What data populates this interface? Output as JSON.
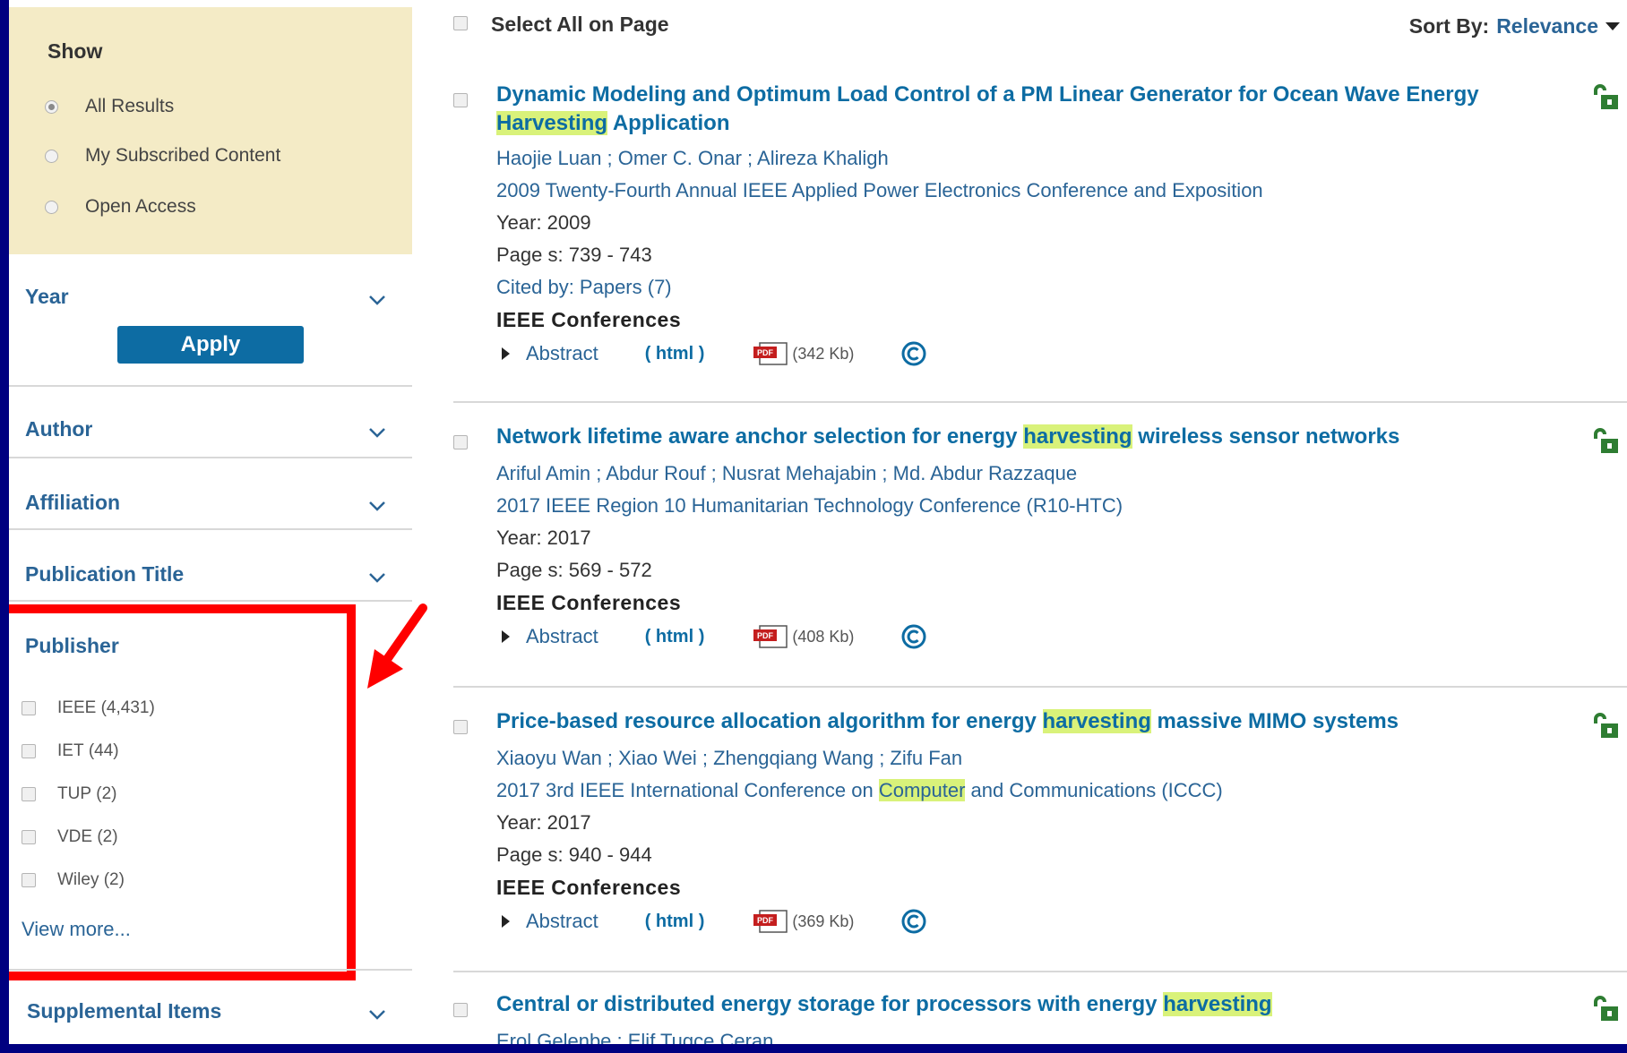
{
  "sidebar": {
    "show": {
      "title": "Show",
      "options": [
        {
          "label": "All Results",
          "selected": true
        },
        {
          "label": "My Subscribed Content",
          "selected": false
        },
        {
          "label": "Open Access",
          "selected": false
        }
      ]
    },
    "year": {
      "title": "Year",
      "apply_label": "Apply"
    },
    "author": {
      "title": "Author"
    },
    "affiliation": {
      "title": "Affiliation"
    },
    "publication_title": {
      "title": "Publication Title"
    },
    "publisher": {
      "title": "Publisher",
      "items": [
        {
          "name": "IEEE",
          "count": "(4,431)"
        },
        {
          "name": "IET",
          "count": "(44)"
        },
        {
          "name": "TUP",
          "count": "(2)"
        },
        {
          "name": "VDE",
          "count": "(2)"
        },
        {
          "name": "Wiley",
          "count": "(2)"
        }
      ],
      "view_more": "View more..."
    },
    "supplemental": {
      "title": "Supplemental Items"
    }
  },
  "main": {
    "select_all_label": "Select All on Page",
    "sort_label": "Sort By:",
    "sort_value": "Relevance",
    "results": [
      {
        "title_parts": [
          "Dynamic Modeling and Optimum Load Control of a PM Linear Generator for Ocean Wave Energy ",
          "Harvesting",
          " Application"
        ],
        "authors": "Haojie Luan ; Omer C. Onar ; Alireza Khaligh",
        "venue": "2009 Twenty-Fourth Annual IEEE Applied Power Electronics Conference and Exposition",
        "year": "Year: 2009",
        "pages": "Page s: 739 - 743",
        "cited": "Cited by: Papers (7)",
        "type": "IEEE Conferences",
        "abstract_label": "Abstract",
        "html_label": "( html )",
        "pdf_size": "(342 Kb)"
      },
      {
        "title_parts": [
          "Network lifetime aware anchor selection for energy ",
          "harvesting",
          " wireless sensor networks"
        ],
        "authors": "Ariful Amin ; Abdur Rouf ; Nusrat Mehajabin ; Md. Abdur Razzaque",
        "venue": "2017 IEEE Region 10 Humanitarian Technology Conference (R10-HTC)",
        "year": "Year: 2017",
        "pages": "Page s: 569 - 572",
        "type": "IEEE Conferences",
        "abstract_label": "Abstract",
        "html_label": "( html )",
        "pdf_size": "(408 Kb)"
      },
      {
        "title_parts": [
          "Price-based resource allocation algorithm for energy ",
          "harvesting",
          " massive MIMO systems"
        ],
        "authors": "Xiaoyu Wan ; Xiao Wei ; Zhengqiang Wang ; Zifu Fan",
        "venue_parts": [
          "2017 3rd IEEE International Conference on ",
          "Computer",
          " and Communications (ICCC)"
        ],
        "year": "Year: 2017",
        "pages": "Page s: 940 - 944",
        "type": "IEEE Conferences",
        "abstract_label": "Abstract",
        "html_label": "( html )",
        "pdf_size": "(369 Kb)"
      },
      {
        "title_parts": [
          "Central or distributed energy storage for processors with energy ",
          "harvesting",
          ""
        ],
        "authors": "Erol Gelenbe ; Elif Tugce Ceran"
      }
    ]
  },
  "colors": {
    "frame": "#000080",
    "link": "#0d6ca3",
    "highlight": "#d9f27a",
    "show_bg": "#f4ebc6",
    "annotation": "#ff0000",
    "lock_green": "#2e7d32"
  },
  "icons": [
    "chevron-down-icon",
    "lock-open-icon",
    "pdf-icon",
    "copyright-icon",
    "caret-right-icon",
    "caret-down-icon",
    "red-arrow-annotation"
  ]
}
